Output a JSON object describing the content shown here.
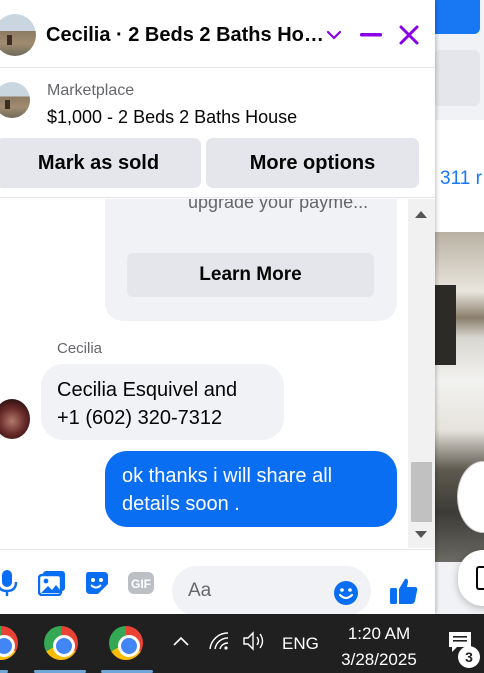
{
  "window": {
    "title": "Cecilia · 2 Beds 2 Baths Ho…",
    "icons": [
      "chevron-down-icon",
      "minimize-icon",
      "close-icon"
    ],
    "accent_color": "#8a00e6"
  },
  "marketplace": {
    "label": "Marketplace",
    "listing_title": "$1,000 - 2 Beds 2 Baths House",
    "mark_sold_label": "Mark as sold",
    "more_options_label": "More options"
  },
  "messages": {
    "card_text": "emails or requests to upgrade your payme...",
    "card_button": "Learn More",
    "incoming": {
      "sender": "Cecilia",
      "text_line1": "Cecilia Esquivel and",
      "text_line2": "+1 (602) 320-7312"
    },
    "outgoing": {
      "text_line1": "ok thanks i will share all",
      "text_line2": "details soon ."
    },
    "outgoing_color": "#0a6ef3"
  },
  "composer": {
    "placeholder": "Aa",
    "icons": [
      "microphone-icon",
      "photo-icon",
      "sticker-icon",
      "gif-icon",
      "emoji-icon",
      "like-icon"
    ],
    "gif_label": "GIF"
  },
  "background_page": {
    "link_text": "311 r"
  },
  "taskbar": {
    "language": "ENG",
    "time": "1:20 AM",
    "date": "3/28/2025",
    "notification_count": "3"
  }
}
